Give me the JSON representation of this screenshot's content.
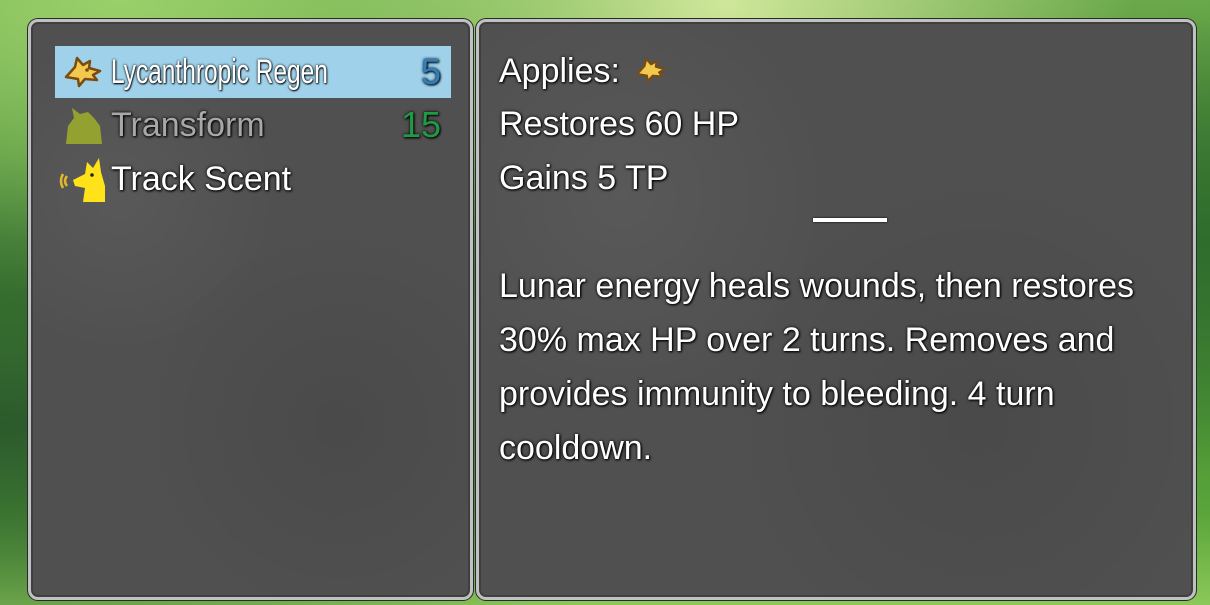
{
  "colors": {
    "selected_bg": "#9fd2ea",
    "cost_blue": "#2e7fc0",
    "cost_green": "#1f9a45",
    "disabled_text": "#a8a8a8",
    "panel_bg": "#505050"
  },
  "skills": [
    {
      "name": "Lycanthropic Regen",
      "cost": "5",
      "icon": "wolf-head-icon",
      "state": "selected"
    },
    {
      "name": "Transform",
      "cost": "15",
      "icon": "beast-silhouette-icon",
      "state": "disabled"
    },
    {
      "name": "Track Scent",
      "cost": "",
      "icon": "sniffing-wolf-icon",
      "state": "normal"
    }
  ],
  "detail": {
    "applies_label": "Applies:",
    "applies_icon": "wolf-head-icon",
    "effects": [
      "Restores 60 HP",
      "Gains 5 TP"
    ],
    "description_lines": [
      "Lunar energy heals wounds, then restores",
      "30% max HP over 2 turns. Removes and",
      "provides immunity to bleeding. 4 turn",
      "cooldown."
    ]
  }
}
